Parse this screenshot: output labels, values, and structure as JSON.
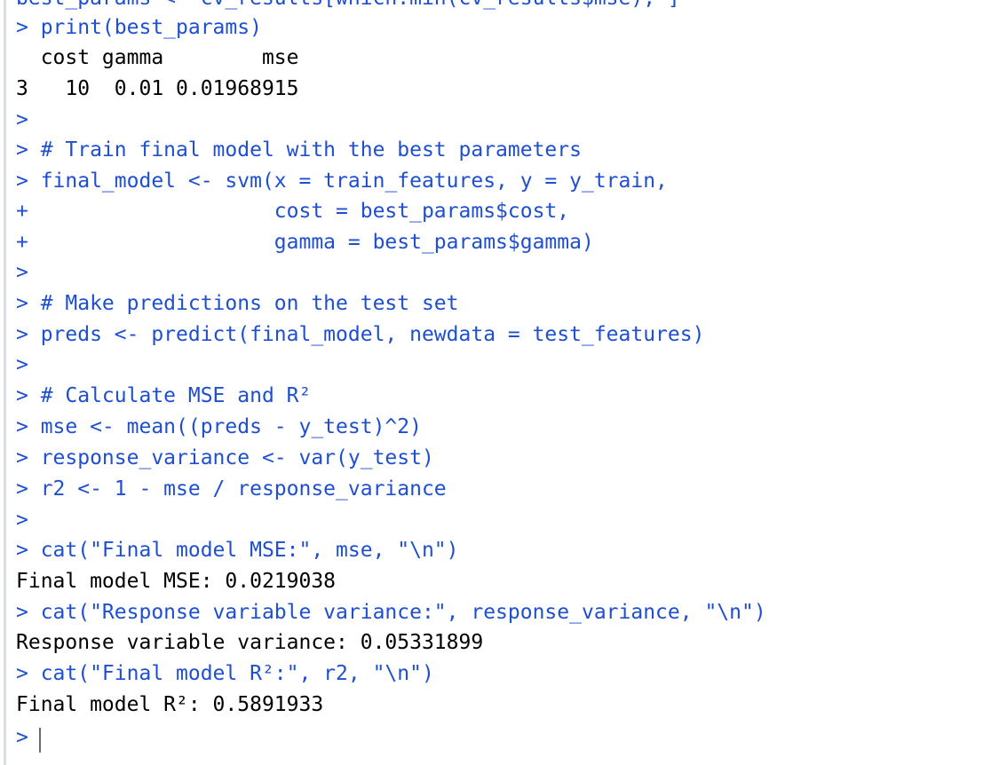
{
  "console": {
    "lines": [
      {
        "kind": "input",
        "text": "best_params <- cv_results[which.min(cv_results$mse), ]"
      },
      {
        "kind": "input",
        "text": "> print(best_params)"
      },
      {
        "kind": "output",
        "text": "  cost gamma        mse"
      },
      {
        "kind": "output",
        "text": "3   10  0.01 0.01968915"
      },
      {
        "kind": "input",
        "text": ">"
      },
      {
        "kind": "input",
        "text": "> # Train final model with the best parameters"
      },
      {
        "kind": "input",
        "text": "> final_model <- svm(x = train_features, y = y_train,"
      },
      {
        "kind": "input",
        "text": "+                    cost = best_params$cost,"
      },
      {
        "kind": "input",
        "text": "+                    gamma = best_params$gamma)"
      },
      {
        "kind": "input",
        "text": ">"
      },
      {
        "kind": "input",
        "text": "> # Make predictions on the test set"
      },
      {
        "kind": "input",
        "text": "> preds <- predict(final_model, newdata = test_features)"
      },
      {
        "kind": "input",
        "text": ">"
      },
      {
        "kind": "input",
        "text": "> # Calculate MSE and R²"
      },
      {
        "kind": "input",
        "text": "> mse <- mean((preds - y_test)^2)"
      },
      {
        "kind": "input",
        "text": "> response_variance <- var(y_test)"
      },
      {
        "kind": "input",
        "text": "> r2 <- 1 - mse / response_variance"
      },
      {
        "kind": "input",
        "text": ">"
      },
      {
        "kind": "input",
        "text": "> cat(\"Final model MSE:\", mse, \"\\n\")"
      },
      {
        "kind": "output",
        "text": "Final model MSE: 0.0219038"
      },
      {
        "kind": "input",
        "text": "> cat(\"Response variable variance:\", response_variance, \"\\n\")"
      },
      {
        "kind": "output",
        "text": "Response variable variance: 0.05331899"
      },
      {
        "kind": "input",
        "text": "> cat(\"Final model R²:\", r2, \"\\n\")"
      },
      {
        "kind": "output",
        "text": "Final model R²: 0.5891933"
      },
      {
        "kind": "input",
        "text": ">"
      }
    ]
  },
  "colors": {
    "input_text": "#1f4fd1",
    "output_text": "#000000",
    "background": "#ffffff"
  }
}
